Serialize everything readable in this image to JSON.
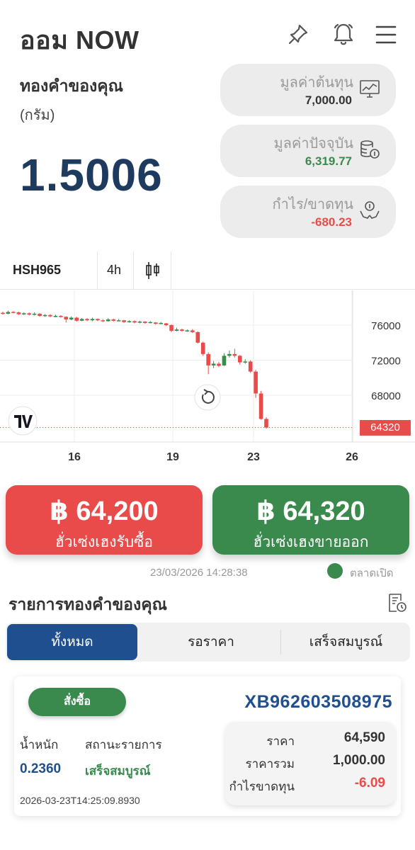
{
  "app": {
    "title": "ออม NOW"
  },
  "gold": {
    "label": "ทองคำของคุณ",
    "unit": "(กรัม)",
    "amount": "1.5006"
  },
  "stats": [
    {
      "label": "มูลค่าต้นทุน",
      "value": "7,000.00",
      "color": "#333333",
      "icon": "chart-monitor-icon"
    },
    {
      "label": "มูลค่าปัจจุบัน",
      "value": "6,319.77",
      "color": "#3a8a4e",
      "icon": "coins-icon"
    },
    {
      "label": "กำไร/ขาดทุน",
      "value": "-680.23",
      "color": "#e94b4b",
      "icon": "money-hands-icon"
    }
  ],
  "chart_toolbar": {
    "symbol": "HSH965",
    "interval": "4h"
  },
  "chart_data": {
    "type": "candlestick",
    "symbol": "HSH965",
    "interval": "4h",
    "y_ticks": [
      "76000",
      "72000",
      "68000"
    ],
    "x_ticks": [
      "16",
      "19",
      "23",
      "26"
    ],
    "ylim": [
      62400,
      78200
    ],
    "last_price": "64320",
    "candles": [
      {
        "o": 77400,
        "c": 77300,
        "h": 77550,
        "l": 77200
      },
      {
        "o": 77300,
        "c": 77500,
        "h": 77650,
        "l": 77250
      },
      {
        "o": 77500,
        "c": 77450,
        "h": 77600,
        "l": 77350
      },
      {
        "o": 77450,
        "c": 77250,
        "h": 77550,
        "l": 77150
      },
      {
        "o": 77250,
        "c": 77350,
        "h": 77450,
        "l": 77150
      },
      {
        "o": 77350,
        "c": 77200,
        "h": 77450,
        "l": 77100
      },
      {
        "o": 77200,
        "c": 77300,
        "h": 77450,
        "l": 77100
      },
      {
        "o": 77300,
        "c": 77050,
        "h": 77350,
        "l": 76950
      },
      {
        "o": 77050,
        "c": 77150,
        "h": 77250,
        "l": 76950
      },
      {
        "o": 77150,
        "c": 77000,
        "h": 77250,
        "l": 76900
      },
      {
        "o": 77000,
        "c": 77050,
        "h": 77200,
        "l": 76900
      },
      {
        "o": 77050,
        "c": 76950,
        "h": 77150,
        "l": 76850
      },
      {
        "o": 76950,
        "c": 76650,
        "h": 77000,
        "l": 76300
      },
      {
        "o": 76650,
        "c": 76850,
        "h": 77000,
        "l": 76550
      },
      {
        "o": 76850,
        "c": 76500,
        "h": 76950,
        "l": 76400
      },
      {
        "o": 76500,
        "c": 76700,
        "h": 76800,
        "l": 76450
      },
      {
        "o": 76700,
        "c": 76550,
        "h": 76800,
        "l": 76450
      },
      {
        "o": 76550,
        "c": 76700,
        "h": 76850,
        "l": 76450
      },
      {
        "o": 76700,
        "c": 76550,
        "h": 76750,
        "l": 76450
      },
      {
        "o": 76550,
        "c": 76450,
        "h": 76650,
        "l": 76350
      },
      {
        "o": 76450,
        "c": 76650,
        "h": 76800,
        "l": 76400
      },
      {
        "o": 76650,
        "c": 76500,
        "h": 76750,
        "l": 76400
      },
      {
        "o": 76500,
        "c": 76550,
        "h": 76700,
        "l": 76450
      },
      {
        "o": 76550,
        "c": 76350,
        "h": 76600,
        "l": 76250
      },
      {
        "o": 76350,
        "c": 76450,
        "h": 76550,
        "l": 76300
      },
      {
        "o": 76450,
        "c": 76300,
        "h": 76550,
        "l": 76200
      },
      {
        "o": 76300,
        "c": 76400,
        "h": 76500,
        "l": 76200
      },
      {
        "o": 76400,
        "c": 76250,
        "h": 76450,
        "l": 76150
      },
      {
        "o": 76250,
        "c": 76350,
        "h": 76450,
        "l": 76200
      },
      {
        "o": 76300,
        "c": 76150,
        "h": 76350,
        "l": 76050
      },
      {
        "o": 76150,
        "c": 76250,
        "h": 76350,
        "l": 76100
      },
      {
        "o": 76200,
        "c": 76000,
        "h": 76250,
        "l": 75900
      },
      {
        "o": 76000,
        "c": 75350,
        "h": 76100,
        "l": 75200
      },
      {
        "o": 75350,
        "c": 75500,
        "h": 75700,
        "l": 75300
      },
      {
        "o": 75500,
        "c": 75350,
        "h": 75600,
        "l": 75250
      },
      {
        "o": 75350,
        "c": 75400,
        "h": 75500,
        "l": 75250
      },
      {
        "o": 75400,
        "c": 75200,
        "h": 75550,
        "l": 75100
      },
      {
        "o": 75200,
        "c": 74000,
        "h": 75300,
        "l": 73900
      },
      {
        "o": 74000,
        "c": 72700,
        "h": 74100,
        "l": 72500
      },
      {
        "o": 72700,
        "c": 71400,
        "h": 72900,
        "l": 70400
      },
      {
        "o": 71400,
        "c": 71600,
        "h": 71900,
        "l": 71100
      },
      {
        "o": 71600,
        "c": 71350,
        "h": 71800,
        "l": 71200
      },
      {
        "o": 71400,
        "c": 72500,
        "h": 72800,
        "l": 71350
      },
      {
        "o": 72500,
        "c": 72700,
        "h": 73100,
        "l": 72300
      },
      {
        "o": 72700,
        "c": 72500,
        "h": 73300,
        "l": 72300
      },
      {
        "o": 72500,
        "c": 71750,
        "h": 72600,
        "l": 71500
      },
      {
        "o": 71750,
        "c": 71850,
        "h": 72100,
        "l": 71600
      },
      {
        "o": 71850,
        "c": 70700,
        "h": 72000,
        "l": 70550
      },
      {
        "o": 70700,
        "c": 68200,
        "h": 70900,
        "l": 67700
      },
      {
        "o": 68200,
        "c": 65300,
        "h": 68500,
        "l": 65200
      },
      {
        "o": 65300,
        "c": 64320,
        "h": 65500,
        "l": 64200
      }
    ]
  },
  "buy": {
    "price": "฿ 64,200",
    "label": "ฮั่วเซ่งเฮงรับซื้อ"
  },
  "sell": {
    "price": "฿ 64,320",
    "label": "ฮั่วเซ่งเฮงขายออก"
  },
  "timestamp": "23/03/2026 14:28:38",
  "market_status": "ตลาดเปิด",
  "orders": {
    "title": "รายการทองคำของคุณ",
    "tabs": [
      "ทั้งหมด",
      "รอราคา",
      "เสร็จสมบูรณ์"
    ],
    "items": [
      {
        "type": "สั่งซื้อ",
        "id": "XB962603508975",
        "weight_label": "น้ำหนัก",
        "weight": "0.2360",
        "status_label": "สถานะรายการ",
        "status": "เสร็จสมบูรณ์",
        "time": "2026-03-23T14:25:09.8930",
        "price_label": "ราคา",
        "price": "64,590",
        "total_label": "ราคารวม",
        "total": "1,000.00",
        "pl_label": "กำไรขาดทุน",
        "pl": "-6.09"
      }
    ]
  },
  "colors": {
    "accent": "#1f4f8f",
    "up": "#3a8a4e",
    "down": "#e94b4b"
  }
}
